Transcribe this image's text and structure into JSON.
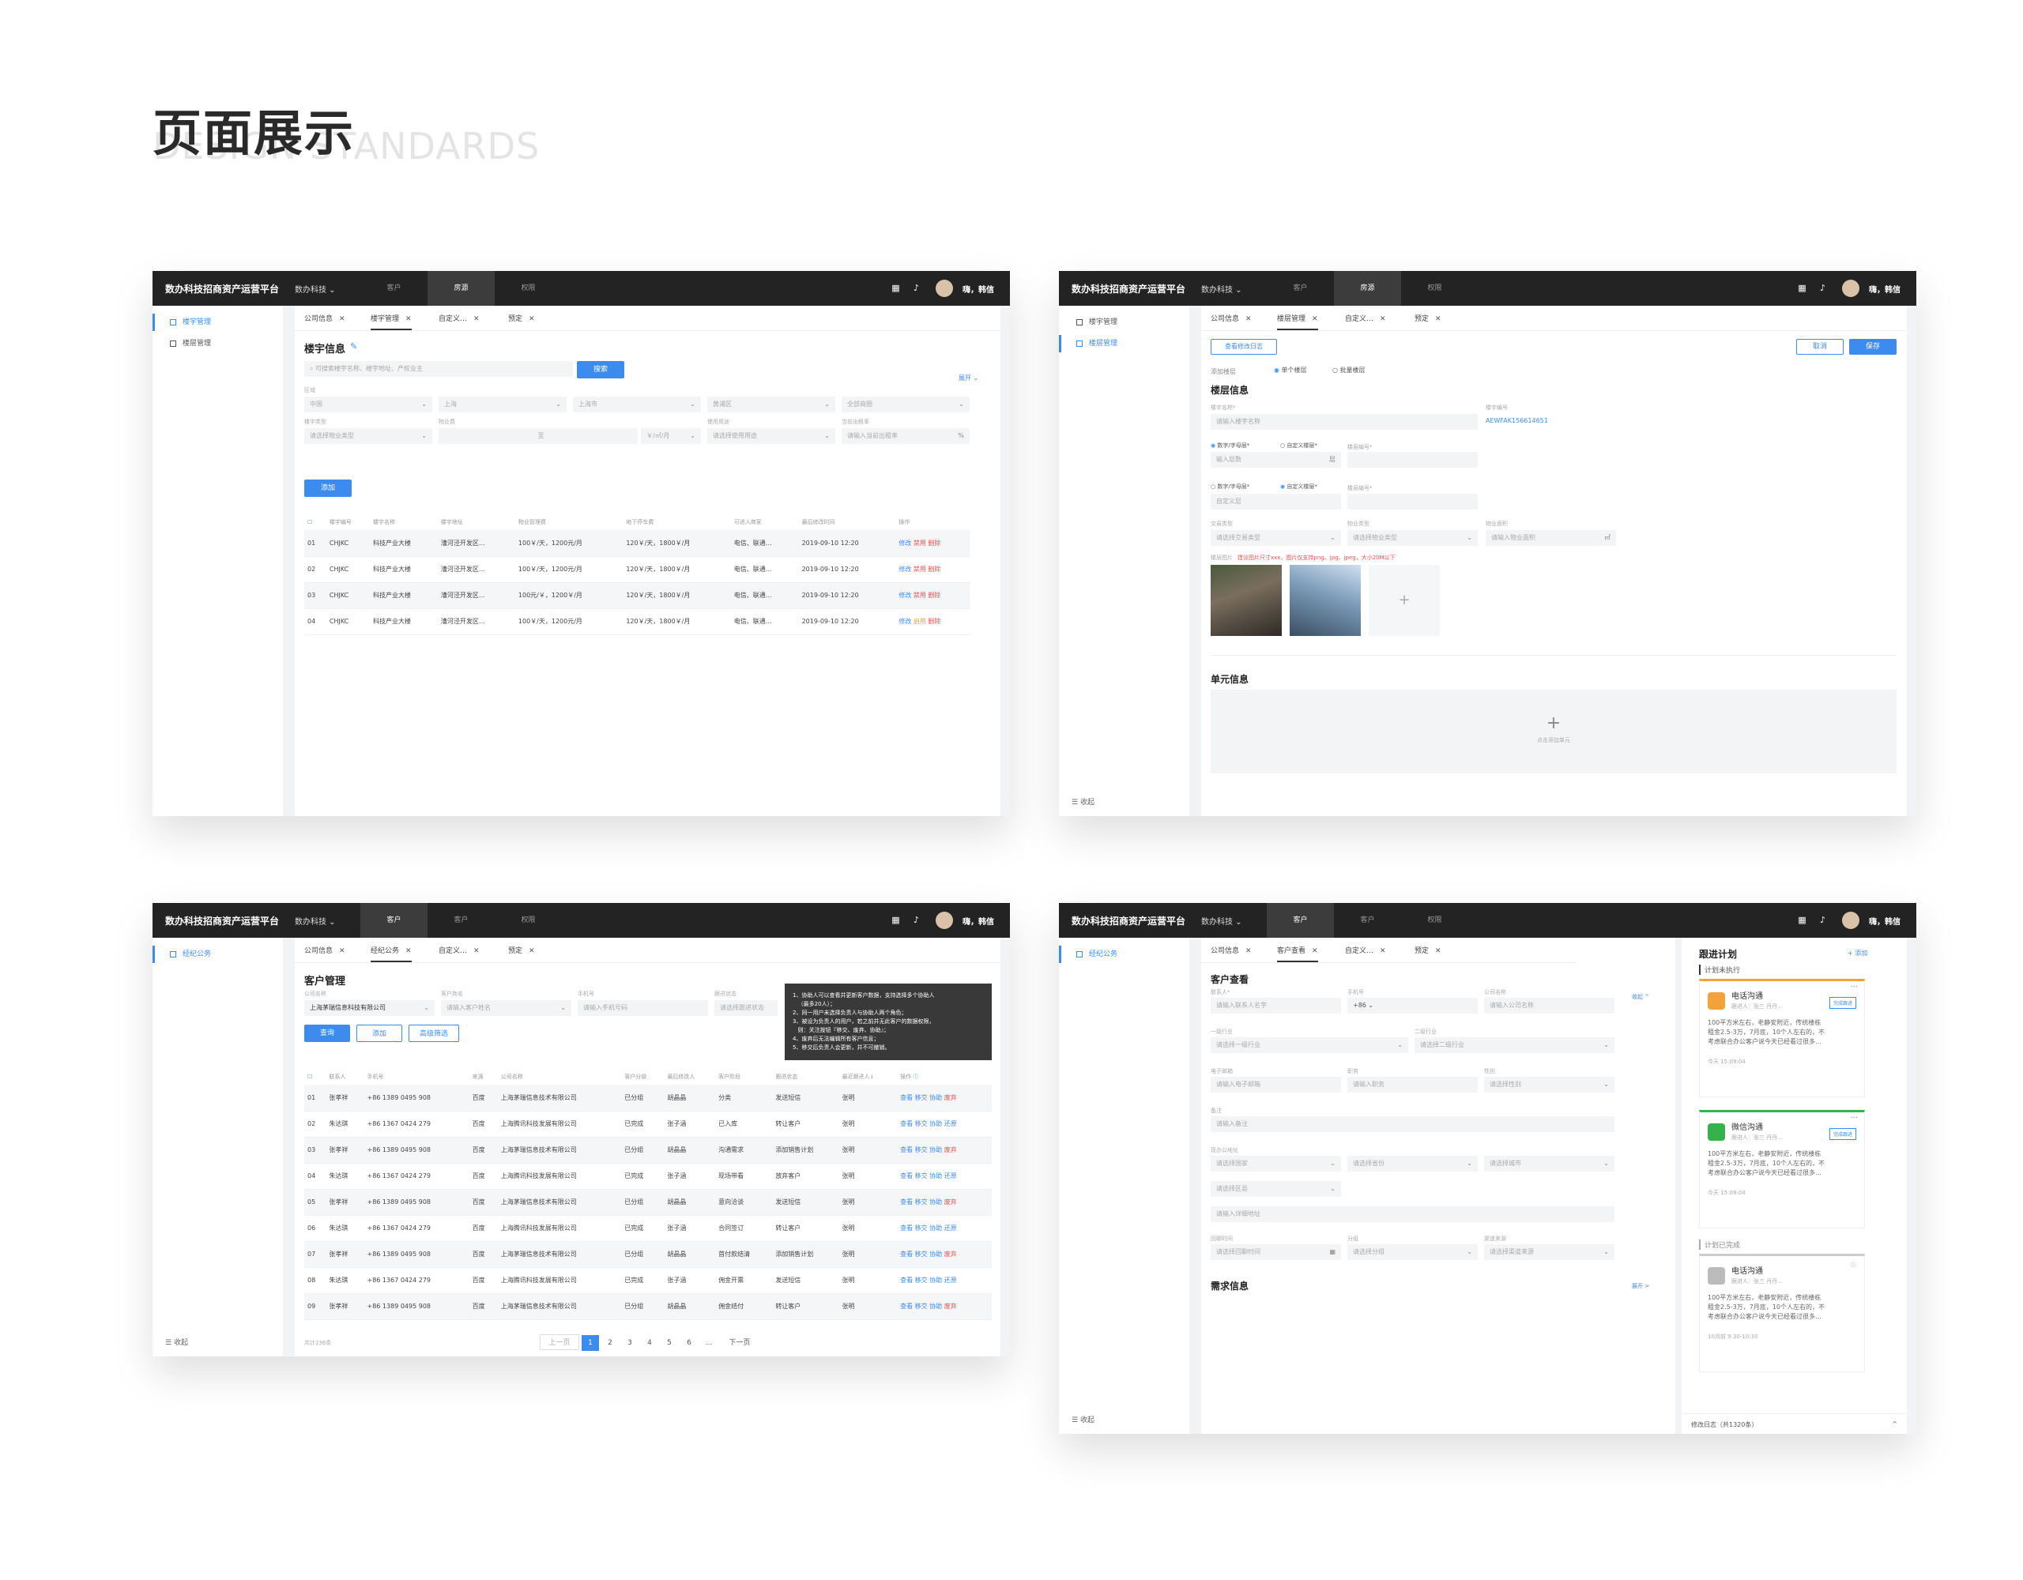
{
  "heading": {
    "title": "页面展示",
    "subtitle": "DESIGN STANDARDS"
  },
  "common": {
    "brand": "数办科技招商资产运营平台",
    "org": "数办科技 ⌄",
    "nav": [
      "客户",
      "房源",
      "权限"
    ],
    "user": "嗨，韩信",
    "fold": "收起"
  },
  "s1": {
    "tabs": [
      "公司信息",
      "楼宇管理",
      "自定义…",
      "预定"
    ],
    "side": [
      "楼宇管理",
      "楼层管理"
    ],
    "title": "楼宇信息",
    "search_placeholder": "可搜索楼宇名称、楼宇地址、产权业主",
    "search_btn": "搜索",
    "expand": "展开 ⌄",
    "f_area": "区域",
    "sel": [
      "中国",
      "上海",
      "上海市",
      "黄浦区",
      "全部商圈"
    ],
    "f_labels": [
      "楼宇类型",
      "物业费",
      "使用用途",
      "当前出租率"
    ],
    "sel2": [
      "请选择物业类型",
      "至",
      "￥/㎡/月",
      "请选择使用用途",
      "请输入当前出租率"
    ],
    "add": "添加",
    "headers": [
      "",
      "楼宇编号",
      "楼宇名称",
      "楼宇地址",
      "物业管理费",
      "地下停车费",
      "可进入商家",
      "最后修改时间",
      "操作"
    ],
    "rows": [
      [
        "01",
        "CHJKC",
        "科技产业大楼",
        "漕河泾开发区…",
        "100￥/天，1200元/月",
        "120￥/天，1800￥/月",
        "电信、联通…",
        "2019-09-10 12:20"
      ],
      [
        "02",
        "CHJKC",
        "科技产业大楼",
        "漕河泾开发区…",
        "100￥/天，1200元/月",
        "120￥/天，1800￥/月",
        "电信、联通…",
        "2019-09-10 12:20"
      ],
      [
        "03",
        "CHJKC",
        "科技产业大楼",
        "漕河泾开发区…",
        "100元/￥，1200￥/月",
        "120￥/天，1800￥/月",
        "电信、联通…",
        "2019-09-10 12:20"
      ],
      [
        "04",
        "CHJKC",
        "科技产业大楼",
        "漕河泾开发区…",
        "100￥/天，1200元/月",
        "120￥/天，1800￥/月",
        "电信、联通…",
        "2019-09-10 12:20"
      ]
    ],
    "ops": [
      "修改",
      "禁用",
      "删除"
    ],
    "ops_alt": [
      "修改",
      "启用",
      "删除"
    ]
  },
  "s2": {
    "tabs": [
      "公司信息",
      "楼层管理",
      "自定义…",
      "预定"
    ],
    "side": [
      "楼宇管理",
      "楼层管理"
    ],
    "log_btn": "查看修改日志",
    "cancel": "取消",
    "save": "保存",
    "add_floor": "添加楼层",
    "radio1": "单个楼层",
    "radio2": "批量楼层",
    "section": "楼层信息",
    "name_lbl": "楼宇名称*",
    "name_ph": "请输入楼宇名称",
    "code_lbl": "楼宇编号",
    "code_val": "AEWFAK156614651",
    "r_num": "数字/字母层*",
    "r_custom": "自定义楼层*",
    "r_code": "楼层编号*",
    "num_ph": "输入层数",
    "unit": "层",
    "custom_ph": "自定义层",
    "f3_labels": [
      "交易类型",
      "物业类型",
      "物业面积"
    ],
    "f3": [
      "请选择交易类型",
      "请选择物业类型",
      "请输入物业面积"
    ],
    "area_unit": "㎡",
    "pic_lbl": "楼层图片",
    "pic_hint": "建议图片尺寸xxx，图片仅支持png、jpg、jpeg，大小20M以下",
    "unit_section": "单元信息",
    "unit_add": "点击添加单元"
  },
  "s3": {
    "tabs": [
      "公司信息",
      "经纪公务",
      "自定义…",
      "预定"
    ],
    "side": [
      "经纪公务"
    ],
    "title": "客户管理",
    "f_labels": [
      "公司名称",
      "客户姓名",
      "手机号",
      "跟进状态"
    ],
    "f_vals": [
      "上海茅瑞信息科技有限公司",
      "请输入客户姓名",
      "请输入手机号码",
      "请选择跟进状态"
    ],
    "btns": [
      "查询",
      "添加",
      "高级筛选"
    ],
    "tooltip": "1、协助人可以查看并更新客户数据，支持选择多个协助人\n   （最多20人）；\n2、同一用户未选择负责人与协助人两个角色；\n3、被设为负责人的用户，若之前并无此客户的数据权限，\n   则：关注按钮『移交、废弃、协助』；\n4、废弃后无法编辑所有客户信息；\n5、移交后负责人会更新，并不可撤销。",
    "headers": [
      "",
      "联系人",
      "手机号",
      "来源",
      "公司名称",
      "客户分级",
      "最后修改人",
      "客户阶段",
      "跟进状态",
      "最近跟进人↓",
      "操作"
    ],
    "rows": [
      [
        "01",
        "张孝祥",
        "+86 1389 0495 908",
        "百度",
        "上海茅瑞信息技术有限公司",
        "已分组",
        "胡晶晶",
        "分类",
        "发送短信",
        "张明"
      ],
      [
        "02",
        "朱达琪",
        "+86 1367 0424 279",
        "百度",
        "上海腾讯科技发展有限公司",
        "已完成",
        "张子涵",
        "已入库",
        "转让客户",
        "张明"
      ],
      [
        "03",
        "张孝祥",
        "+86 1389 0495 908",
        "百度",
        "上海茅瑞信息技术有限公司",
        "已分组",
        "胡晶晶",
        "沟通需求",
        "添加销售计划",
        "张明"
      ],
      [
        "04",
        "朱达琪",
        "+86 1367 0424 279",
        "百度",
        "上海腾讯科技发展有限公司",
        "已完成",
        "张子涵",
        "现场带看",
        "放弃客户",
        "张明"
      ],
      [
        "05",
        "张孝祥",
        "+86 1389 0495 908",
        "百度",
        "上海茅瑞信息技术有限公司",
        "已分组",
        "胡晶晶",
        "意向洽谈",
        "发送短信",
        "张明"
      ],
      [
        "06",
        "朱达琪",
        "+86 1367 0424 279",
        "百度",
        "上海腾讯科技发展有限公司",
        "已完成",
        "张子涵",
        "合同签订",
        "转让客户",
        "张明"
      ],
      [
        "07",
        "张孝祥",
        "+86 1389 0495 908",
        "百度",
        "上海茅瑞信息技术有限公司",
        "已分组",
        "胡晶晶",
        "首付款结清",
        "添加销售计划",
        "张明"
      ],
      [
        "08",
        "朱达琪",
        "+86 1367 0424 279",
        "百度",
        "上海腾讯科技发展有限公司",
        "已完成",
        "张子涵",
        "佣金开票",
        "发送短信",
        "张明"
      ],
      [
        "09",
        "张孝祥",
        "+86 1389 0495 908",
        "百度",
        "上海茅瑞信息技术有限公司",
        "已分组",
        "胡晶晶",
        "佣金结付",
        "转让客户",
        "张明"
      ]
    ],
    "ops": [
      "查看",
      "移交",
      "协助",
      "废弃"
    ],
    "ops_alt": [
      "查看",
      "移交",
      "协助",
      "还原"
    ],
    "total": "共计236条",
    "prev": "上一页",
    "pages": [
      "1",
      "2",
      "3",
      "4",
      "5",
      "6",
      "…"
    ],
    "next": "下一页"
  },
  "s4": {
    "tabs": [
      "公司信息",
      "客户查看",
      "自定义…",
      "预定"
    ],
    "side": [
      "经纪公务"
    ],
    "title": "客户查看",
    "collapse": "收起 ^",
    "r1_labels": [
      "联系人*",
      "手机号",
      "公司名称"
    ],
    "r1": [
      "请输入联系人名字",
      "+86 ⌄",
      "请输入公司名称"
    ],
    "r2_labels": [
      "一级行业",
      "二级行业"
    ],
    "r2": [
      "请选择一级行业",
      "请选择二级行业"
    ],
    "r3_labels": [
      "电子邮箱",
      "职务",
      "性别"
    ],
    "r3": [
      "请输入电子邮箱",
      "请输入职务",
      "请选择性别"
    ],
    "r4_label": "备注",
    "r4": "请输入备注",
    "r5_label": "现办公地址",
    "r5": [
      "请选择国家",
      "请选择省份",
      "请选择城市"
    ],
    "r6": "请选择区县",
    "r7": "请输入详细地址",
    "r8_labels": [
      "回聊时间",
      "分组",
      "渠道来源"
    ],
    "r8": [
      "请选择回聊时间",
      "请选择分组",
      "请选择渠道来源"
    ],
    "need": "需求信息",
    "expand": "展开 >",
    "plan_title": "跟进计划",
    "plan_add": "+ 添加",
    "todo": "计划未执行",
    "done": "计划已完成",
    "cards": [
      {
        "title": "电话沟通",
        "sub": "跟进人：张三   丹丹…",
        "body": "100平方米左右，老静安附近，传统楼栋租金2.5-3万，7月底，10个人左右的，不考虑联合办公客户说今天已经看过很多…",
        "time": "今天 15:09:04",
        "tag": "完成跟进"
      },
      {
        "title": "微信沟通",
        "sub": "跟进人：张三   丹丹…",
        "body": "100平方米左右，老静安附近，传统楼栋租金2.5-3万，7月底，10个人左右的，不考虑联合办公客户说今天已经看过很多…",
        "time": "今天 15:09:04",
        "tag": "完成跟进"
      },
      {
        "title": "电话沟通",
        "sub": "跟进人：张三   丹丹…",
        "body": "100平方米左右，老静安附近，传统楼栋租金2.5-3万，7月底，10个人左右的，不考虑联合办公客户说今天已经看过很多…",
        "time": "10月前  9:30-10:30",
        "tag": ""
      }
    ],
    "log": "修改日志（共1320条）",
    "log_arrow": "^"
  },
  "colors": {
    "accent": "#3c8cf0",
    "danger": "#f05050",
    "topbar": "#232323",
    "warn": "#f5a23c",
    "wechat": "#34b24c"
  }
}
